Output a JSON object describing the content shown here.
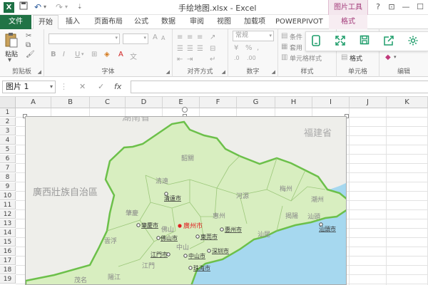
{
  "titlebar": {
    "title": "手绘地图.xlsx - Excel",
    "picture_tools": "图片工具",
    "help": "?",
    "restore": "⊡",
    "minimize": "—",
    "maximize": "☐",
    "close": "✕"
  },
  "tabs": {
    "file": "文件",
    "home": "开始",
    "insert": "插入",
    "page_layout": "页面布局",
    "formulas": "公式",
    "data": "数据",
    "review": "审阅",
    "view": "视图",
    "addins": "加载项",
    "powerpivot": "POWERPIVOT",
    "format": "格式"
  },
  "ribbon": {
    "clipboard": {
      "label": "剪贴板",
      "paste": "粘贴"
    },
    "font": {
      "label": "字体",
      "bold": "B",
      "italic": "I",
      "underline": "U",
      "grow": "A",
      "size_up": "A",
      "size_down": "A"
    },
    "alignment": {
      "label": "对齐方式"
    },
    "number": {
      "label": "数字",
      "format_value": "常规"
    },
    "styles": {
      "label": "样式",
      "conditional": "条件",
      "table": "套用",
      "cell_styles": "单元格样式"
    },
    "cells": {
      "label": "单元格",
      "format": "格式"
    },
    "editing": {
      "label": "编辑"
    }
  },
  "formulabar": {
    "namebox_value": "图片 1",
    "cancel": "✕",
    "enter": "✓",
    "fx": "fx",
    "formula_value": ""
  },
  "grid": {
    "columns": [
      "A",
      "B",
      "C",
      "D",
      "E",
      "F",
      "G",
      "H",
      "I",
      "J",
      "K"
    ],
    "rows": [
      "1",
      "2",
      "3",
      "4",
      "5",
      "6",
      "7",
      "8",
      "9",
      "10",
      "11",
      "12",
      "13",
      "14",
      "15",
      "16",
      "17",
      "18",
      "19"
    ]
  },
  "map": {
    "neighbor_north": "湖南省",
    "neighbor_east": "福建省",
    "neighbor_west": "廣西壯族自治區",
    "regions": [
      "韶關",
      "清遠",
      "河源",
      "梅州",
      "潮州",
      "肇慶",
      "佛山",
      "廣州",
      "惠州",
      "揭陽",
      "汕頭",
      "汕尾",
      "雲浮",
      "江門",
      "中山",
      "茂名",
      "陽江"
    ],
    "cities": {
      "qingyuan": "清遠市",
      "zhaoqing": "肇慶市",
      "guangzhou": "廣州市",
      "foshan": "佛山市",
      "dongguan": "東莞市",
      "huizhou": "惠州市",
      "shantou": "汕頭市",
      "jiangmen": "江門市",
      "zhongshan": "中山市",
      "shenzhen": "深圳市",
      "zhuhai": "珠海市"
    }
  },
  "colors": {
    "excel_green": "#217346",
    "picture_tools_pink": "#a33b7a",
    "land": "#d8eec0",
    "neighbor": "#eeeeea",
    "sea": "#a6d8ef",
    "border_green": "#6cc04a",
    "capital_red": "#e02020"
  }
}
